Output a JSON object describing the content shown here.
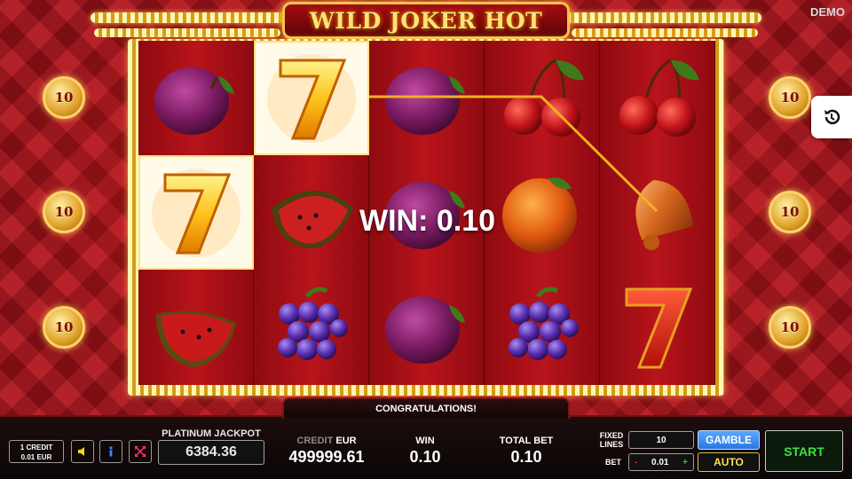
{
  "app": {
    "title": "WILD JOKER HOT",
    "mode_label": "DEMO"
  },
  "side_coins": {
    "left": [
      "10",
      "10",
      "10"
    ],
    "right": [
      "10",
      "10",
      "10"
    ]
  },
  "reels": [
    [
      "plum-icon",
      "seven-icon",
      "watermelon-icon"
    ],
    [
      "seven-icon",
      "watermelon-icon",
      "grapes-icon"
    ],
    [
      "plum-icon",
      "plum-icon",
      "plum-icon"
    ],
    [
      "cherries-icon",
      "orange-icon",
      "grapes-icon"
    ],
    [
      "cherries-icon",
      "bell-icon",
      "seven-icon"
    ]
  ],
  "highlighted_cells": [
    "reel-1-row-1",
    "reel-0-row-2"
  ],
  "win": {
    "text": "WIN: 0.10",
    "congrats": "CONGRATULATIONS!"
  },
  "panel": {
    "credit_box_line1": "1 CREDIT",
    "credit_box_line2": "0.01 EUR",
    "jackpot_label": "PLATINUM JACKPOT",
    "jackpot_value": "6384.36",
    "credit_label_dim": "CREDIT",
    "credit_label_unit": "EUR",
    "credit_value": "499999.61",
    "win_label": "WIN",
    "win_value": "0.10",
    "total_bet_label": "TOTAL BET",
    "total_bet_value": "0.10",
    "fixed_lines_label1": "FIXED",
    "fixed_lines_label2": "LINES",
    "fixed_lines_value": "10",
    "bet_label": "BET",
    "bet_minus": "-",
    "bet_value": "0.01",
    "bet_plus": "+",
    "gamble_label": "GAMBLE",
    "auto_label": "AUTO",
    "start_label": "START"
  },
  "colors": {
    "gamble": "#2a76e0",
    "start_text": "#3ee03e",
    "auto_text": "#ffe04a",
    "win_line": "#f0b020"
  }
}
